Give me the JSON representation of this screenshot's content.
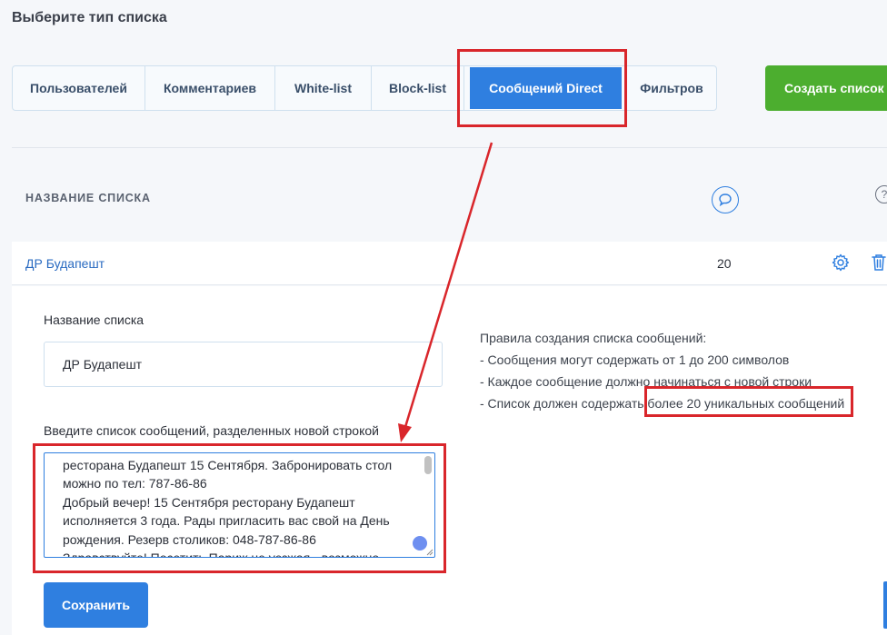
{
  "page_title": "Выберите тип списка",
  "tabs": [
    {
      "label": "Пользователей"
    },
    {
      "label": "Комментариев"
    },
    {
      "label": "White-list"
    },
    {
      "label": "Block-list"
    },
    {
      "label": "Сообщений Direct",
      "active": true
    },
    {
      "label": "Фильтров"
    }
  ],
  "create_button": "Создать список",
  "list_header": "НАЗВАНИЕ СПИСКА",
  "header_help": "?",
  "row": {
    "name": "ДР Будапешт",
    "count": "20"
  },
  "form": {
    "name_label": "Название списка",
    "name_value": "ДР Будапешт",
    "messages_label": "Введите список сообщений, разделенных новой строкой",
    "messages_value": "ресторана Будапешт 15 Сентября. Забронировать стол\nможно по тел: 787-86-86\nДобрый вечер! 15 Сентября ресторану Будапешт\nисполняется 3 года. Рады пригласить вас свой на День\nрождения. Резерв столиков: 048-787-86-86\nЗдравствуйте! Посетить Париж не уезжая - возможно",
    "save_button": "Сохранить"
  },
  "rules": {
    "title": "Правила создания списка сообщений:",
    "items": [
      "- Сообщения могут содержать от 1 до 200 символов",
      "- Каждое сообщение должно начинаться с новой строки",
      "- Список должен содержать более 20 уникальных сообщений"
    ]
  },
  "colors": {
    "accent": "#2f7fe0",
    "success": "#4cae2f",
    "annotation": "#d9262b"
  },
  "icons": [
    "chat-icon",
    "help-icon",
    "gear-icon",
    "trash-icon"
  ]
}
